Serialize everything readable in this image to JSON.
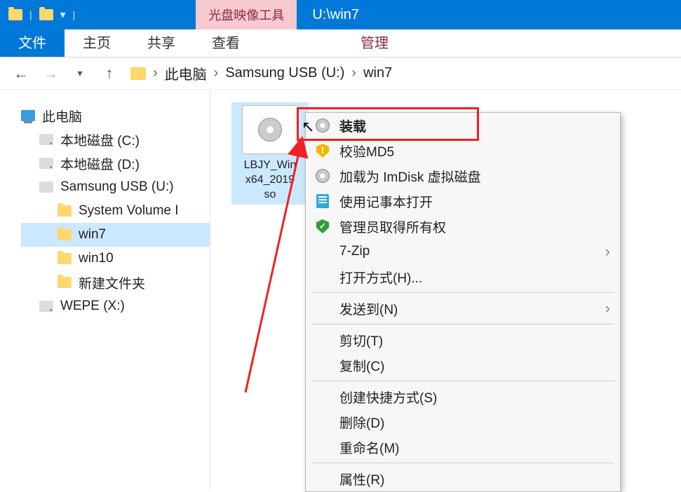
{
  "titlebar": {
    "context_tab": "光盘映像工具",
    "title": "U:\\win7"
  },
  "ribbon": {
    "tabs": [
      {
        "label": "文件",
        "active": true
      },
      {
        "label": "主页"
      },
      {
        "label": "共享"
      },
      {
        "label": "查看"
      },
      {
        "label": "管理",
        "ctx": true
      }
    ]
  },
  "breadcrumb": {
    "items": [
      "此电脑",
      "Samsung USB (U:)",
      "win7"
    ]
  },
  "tree": {
    "items": [
      {
        "label": "此电脑",
        "icon": "pc",
        "indent": 0
      },
      {
        "label": "本地磁盘 (C:)",
        "icon": "drive",
        "indent": 1
      },
      {
        "label": "本地磁盘 (D:)",
        "icon": "drive",
        "indent": 1
      },
      {
        "label": "Samsung USB (U:)",
        "icon": "usb",
        "indent": 1
      },
      {
        "label": "System Volume I",
        "icon": "folder",
        "indent": 2
      },
      {
        "label": "win7",
        "icon": "folder",
        "indent": 2,
        "selected": true
      },
      {
        "label": "win10",
        "icon": "folder",
        "indent": 2
      },
      {
        "label": "新建文件夹",
        "icon": "folder",
        "indent": 2
      },
      {
        "label": "WEPE (X:)",
        "icon": "drive",
        "indent": 1
      }
    ]
  },
  "content": {
    "files": [
      {
        "name": "LBJY_Win\nx64_2019\nso",
        "type": "iso",
        "selected": true
      }
    ]
  },
  "context_menu": {
    "items": [
      {
        "label": "装载",
        "icon": "disc",
        "bold": true,
        "highlight": true
      },
      {
        "label": "校验MD5",
        "icon": "shield-y"
      },
      {
        "label": "加载为 ImDisk 虚拟磁盘",
        "icon": "disc"
      },
      {
        "label": "使用记事本打开",
        "icon": "note"
      },
      {
        "label": "管理员取得所有权",
        "icon": "shield-g"
      },
      {
        "label": "7-Zip",
        "submenu": true
      },
      {
        "label": "打开方式(H)..."
      },
      {
        "sep": true
      },
      {
        "label": "发送到(N)",
        "submenu": true
      },
      {
        "sep": true
      },
      {
        "label": "剪切(T)"
      },
      {
        "label": "复制(C)"
      },
      {
        "sep": true
      },
      {
        "label": "创建快捷方式(S)"
      },
      {
        "label": "删除(D)"
      },
      {
        "label": "重命名(M)"
      },
      {
        "sep": true
      },
      {
        "label": "属性(R)"
      }
    ]
  }
}
